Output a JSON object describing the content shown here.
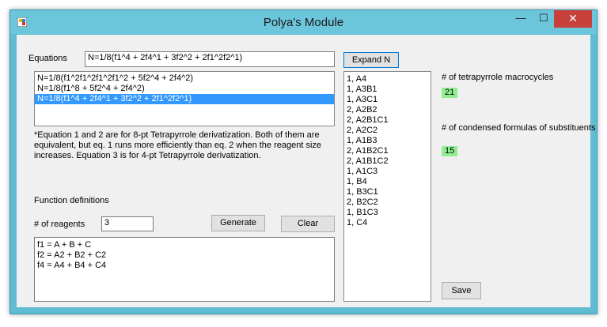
{
  "window": {
    "title": "Polya's Module",
    "controls": {
      "minimize": "—",
      "maximize": "☐",
      "close": "✕"
    },
    "colors": {
      "frame": "#5fbcd3",
      "close": "#c7413a",
      "selection": "#3399ff",
      "chip": "#90ee90"
    }
  },
  "equations": {
    "label": "Equations",
    "input_value": "N=1/8(f1^4 + 2f4^1 + 3f2^2 + 2f1^2f2^1)",
    "list": [
      "N=1/8(f1^2f1^2f1^2f1^2 + 5f2^4 + 2f4^2)",
      "N=1/8(f1^8 + 5f2^4 + 2f4^2)",
      "N=1/8(f1^4 + 2f4^1 + 3f2^2 + 2f1^2f2^1)"
    ],
    "selected_index": 2
  },
  "note": {
    "line1": "*Equation 1 and 2 are for 8-pt Tetrapyrrole derivatization.  Both of them are",
    "line2": "equivalent, but eq. 1 runs more efficiently than eq. 2 when the reagent size",
    "line3": "increases.  Equation 3 is for 4-pt Tetrapyrrole derivatization."
  },
  "functions": {
    "title": "Function definitions",
    "reagents_label": "# of reagents",
    "reagents_value": "3",
    "generate_label": "Generate",
    "clear_label": "Clear",
    "definitions": [
      "f1 = A + B + C",
      "f2 = A2 + B2 + C2",
      "f4 = A4 + B4 + C4"
    ]
  },
  "expand": {
    "button_label": "Expand N",
    "results": [
      "1, A4",
      "1, A3B1",
      "1, A3C1",
      "2, A2B2",
      "2, A2B1C1",
      "2, A2C2",
      "1, A1B3",
      "2, A1B2C1",
      "2, A1B1C2",
      "1, A1C3",
      "1, B4",
      "1, B3C1",
      "2, B2C2",
      "1, B1C3",
      "1, C4"
    ]
  },
  "stats": {
    "macrocycles_label": "# of tetrapyrrole macrocycles",
    "macrocycles_value": "21",
    "formulas_label": "# of condensed formulas of substituents",
    "formulas_value": "15"
  },
  "save_label": "Save"
}
